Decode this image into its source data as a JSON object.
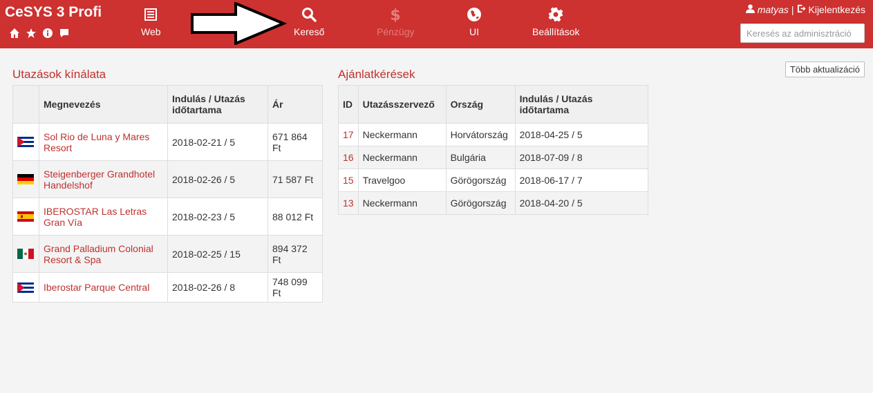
{
  "app": {
    "title": "CeSYS 3 Profi"
  },
  "quick_icons": [
    "home-icon",
    "star-icon",
    "info-icon",
    "comment-icon"
  ],
  "nav": [
    {
      "label": "Web",
      "icon": "list-icon",
      "disabled": false
    },
    {
      "label": "Kereső",
      "icon": "search-icon",
      "disabled": false
    },
    {
      "label": "Pénzügy",
      "icon": "dollar-icon",
      "disabled": true
    },
    {
      "label": "UI",
      "icon": "globe-icon",
      "disabled": false
    },
    {
      "label": "Beállítások",
      "icon": "gear-icon",
      "disabled": false
    }
  ],
  "user": {
    "name": "matyas",
    "separator": "|",
    "logout": "Kijelentkezés"
  },
  "admin_search": {
    "placeholder": "Keresés az adminisztráció"
  },
  "refresh_button": "Több aktualizáció",
  "offers": {
    "title": "Utazások kínálata",
    "headers": [
      "",
      "Megnevezés",
      "Indulás / Utazás időtartama",
      "Ár"
    ],
    "rows": [
      {
        "flag": "cuba",
        "name": "Sol Rio de Luna y Mares Resort",
        "date": "2018-02-21 / 5",
        "price": "671 864 Ft"
      },
      {
        "flag": "germany",
        "name": "Steigenberger Grandhotel Handelshof",
        "date": "2018-02-26 / 5",
        "price": "71 587 Ft"
      },
      {
        "flag": "spain",
        "name": "IBEROSTAR Las Letras Gran Vía",
        "date": "2018-02-23 / 5",
        "price": "88 012 Ft"
      },
      {
        "flag": "mexico",
        "name": "Grand Palladium Colonial Resort & Spa",
        "date": "2018-02-25 / 15",
        "price": "894 372 Ft"
      },
      {
        "flag": "cuba",
        "name": "Iberostar Parque Central",
        "date": "2018-02-26 / 8",
        "price": "748 099 Ft"
      }
    ]
  },
  "requests": {
    "title": "Ajánlatkérések",
    "headers": [
      "ID",
      "Utazásszervező",
      "Ország",
      "Indulás / Utazás időtartama"
    ],
    "rows": [
      {
        "id": "17",
        "organizer": "Neckermann",
        "country": "Horvátország",
        "date": "2018-04-25 / 5"
      },
      {
        "id": "16",
        "organizer": "Neckermann",
        "country": "Bulgária",
        "date": "2018-07-09 / 8"
      },
      {
        "id": "15",
        "organizer": "Travelgoo",
        "country": "Görögország",
        "date": "2018-06-17 / 7"
      },
      {
        "id": "13",
        "organizer": "Neckermann",
        "country": "Görögország",
        "date": "2018-04-20 / 5"
      }
    ]
  },
  "colors": {
    "header_bg": "#cd3130",
    "link": "#c0302f",
    "disabled_nav": "#e47f7e"
  }
}
